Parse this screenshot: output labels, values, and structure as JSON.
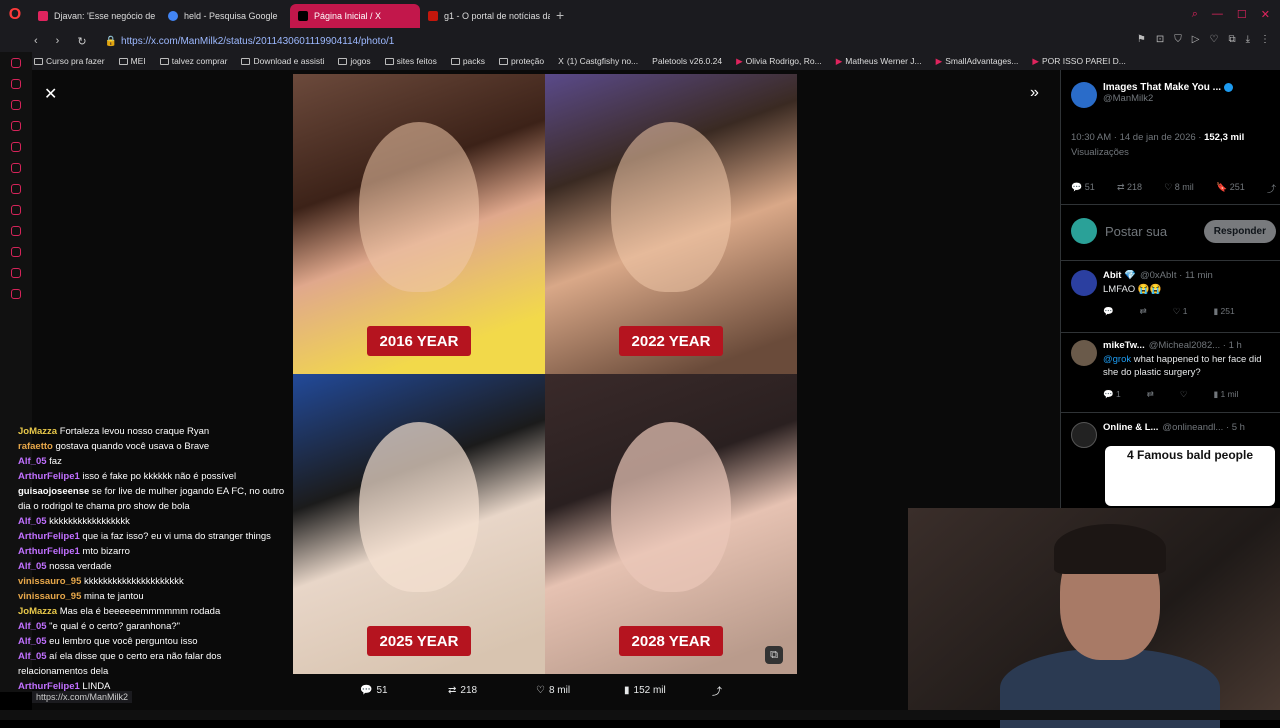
{
  "tabs": [
    {
      "label": "Djavan: 'Esse negócio de",
      "color": "#e0245e"
    },
    {
      "label": "held - Pesquisa Google",
      "color": "#4285f4"
    },
    {
      "label": "Página Inicial / X",
      "color": "#ffffff"
    },
    {
      "label": "g1 - O portal de notícias da",
      "color": "#c4170c"
    }
  ],
  "address": {
    "url": "https://x.com/ManMilk2/status/2011430601119904114/photo/1"
  },
  "bookmarks": [
    "Curso pra fazer",
    "MEI",
    "talvez comprar",
    "Download e assisti",
    "jogos",
    "sites feitos",
    "packs",
    "proteção",
    "(1) Castgfishy no...",
    "Paletools v26.0.24",
    "Olivia Rodrigo, Ro...",
    "Matheus Werner J...",
    "SmallAdvantages...",
    "POR ISSO PAREI D..."
  ],
  "photo": {
    "labels": [
      "2016 YEAR",
      "2022 YEAR",
      "2025 YEAR",
      "2028 YEAR"
    ]
  },
  "actions": {
    "replies": "51",
    "reposts": "218",
    "likes": "8 mil",
    "views": "152 mil"
  },
  "post": {
    "author": "Images That Make You ...",
    "handle": "@ManMilk2",
    "time": "10:30 AM · 14 de jan de 2026 · ",
    "views": "152,3 mil",
    "views_label": "Visualizações",
    "stats": {
      "replies": "51",
      "reposts": "218",
      "likes": "8 mil",
      "bookmarks": "251"
    },
    "reply_placeholder": "Postar sua",
    "reply_button": "Responder"
  },
  "replies": [
    {
      "name": "Abit 💎",
      "handle": "@0xAbIt · 11 min",
      "text": "LMFAO 😭😭",
      "stats": [
        "",
        "",
        "1",
        "251"
      ],
      "avatar": "#2b3fa0"
    },
    {
      "name": "mikeTw...",
      "handle": "@Micheal2082... · 1 h",
      "mention": "@grok",
      "text": " what happened to her face did she do plastic surgery?",
      "stats": [
        "1",
        "",
        "",
        "1 mil"
      ],
      "avatar": "#6a5a4a"
    },
    {
      "name": "Online & L...",
      "handle": "@onlineandl... · 5 h",
      "text": "",
      "ad_title": "4 Famous bald people",
      "avatar": "#222"
    }
  ],
  "chat": [
    {
      "user": "JoMazza",
      "color": "#e8c84a",
      "text": "Fortaleza levou nosso craque Ryan"
    },
    {
      "user": "rafaetto",
      "color": "#e8a84a",
      "text": "gostava quando você usava o Brave"
    },
    {
      "user": "Alf_05",
      "color": "#c070ff",
      "text": "faz"
    },
    {
      "user": "ArthurFelipe1",
      "color": "#c070ff",
      "text": "isso é fake po kkkkkk não é possível"
    },
    {
      "user": "guisaojoseense",
      "color": "#ffffff",
      "text": "se for live de mulher jogando EA FC, no outro dia o rodrigol te chama pro show de bola"
    },
    {
      "user": "Alf_05",
      "color": "#c070ff",
      "text": "kkkkkkkkkkkkkkkkk"
    },
    {
      "user": "ArthurFelipe1",
      "color": "#c070ff",
      "text": "que ia faz isso? eu vi uma do stranger things"
    },
    {
      "user": "ArthurFelipe1",
      "color": "#c070ff",
      "text": "mto bizarro"
    },
    {
      "user": "Alf_05",
      "color": "#c070ff",
      "text": "nossa verdade"
    },
    {
      "user": "vinissauro_95",
      "color": "#e8a84a",
      "text": "kkkkkkkkkkkkkkkkkkkkk"
    },
    {
      "user": "vinissauro_95",
      "color": "#e8a84a",
      "text": "mina te jantou"
    },
    {
      "user": "JoMazza",
      "color": "#e8c84a",
      "text": "Mas ela é beeeeeemmmmmm rodada"
    },
    {
      "user": "Alf_05",
      "color": "#c070ff",
      "text": "\"e qual é o certo? garanhona?\""
    },
    {
      "user": "Alf_05",
      "color": "#c070ff",
      "text": "eu lembro que você perguntou isso"
    },
    {
      "user": "Alf_05",
      "color": "#c070ff",
      "text": "aí ela disse que o certo era não falar dos relacionamentos dela"
    },
    {
      "user": "ArthurFelipe1",
      "color": "#c070ff",
      "text": "LINDA"
    }
  ],
  "status_url": "https://x.com/ManMilk2"
}
